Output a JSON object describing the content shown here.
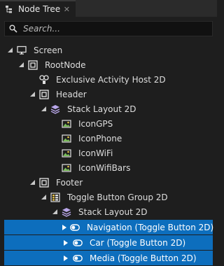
{
  "panel": {
    "title": "Node Tree",
    "close_glyph": "✕"
  },
  "search": {
    "placeholder": "Search..."
  },
  "tree": [
    {
      "label": "Screen",
      "icon": "monitor-icon",
      "level": 0,
      "expanded": true
    },
    {
      "label": "RootNode",
      "icon": "node-box-icon",
      "level": 1,
      "expanded": true
    },
    {
      "label": "Exclusive Activity Host 2D",
      "icon": "activity-host-icon",
      "level": 2
    },
    {
      "label": "Header",
      "icon": "node-box-icon",
      "level": 2,
      "expanded": true
    },
    {
      "label": "Stack Layout 2D",
      "icon": "stack-layers-icon",
      "level": 3,
      "expanded": true
    },
    {
      "label": "IconGPS",
      "icon": "image-icon",
      "level": 4
    },
    {
      "label": "IconPhone",
      "icon": "image-icon",
      "level": 4
    },
    {
      "label": "IconWiFi",
      "icon": "image-icon",
      "level": 4
    },
    {
      "label": "IconWifiBars",
      "icon": "image-icon",
      "level": 4
    },
    {
      "label": "Footer",
      "icon": "node-box-icon",
      "level": 2,
      "expanded": true
    },
    {
      "label": "Toggle Button Group 2D",
      "icon": "button-group-icon",
      "level": 3,
      "expanded": true
    },
    {
      "label": "Stack Layout 2D",
      "icon": "stack-layers-icon",
      "level": 4,
      "expanded": true
    },
    {
      "label": "Navigation (Toggle Button 2D)",
      "icon": "toggle-icon",
      "level": 5,
      "collapsed": true,
      "selected": true
    },
    {
      "label": "Car (Toggle Button 2D)",
      "icon": "toggle-icon",
      "level": 5,
      "collapsed": true,
      "selected": true
    },
    {
      "label": "Media (Toggle Button 2D)",
      "icon": "toggle-icon",
      "level": 5,
      "collapsed": true,
      "selected": true
    }
  ],
  "colors": {
    "selection": "#0d6ebd",
    "background": "#1e1e1e"
  }
}
